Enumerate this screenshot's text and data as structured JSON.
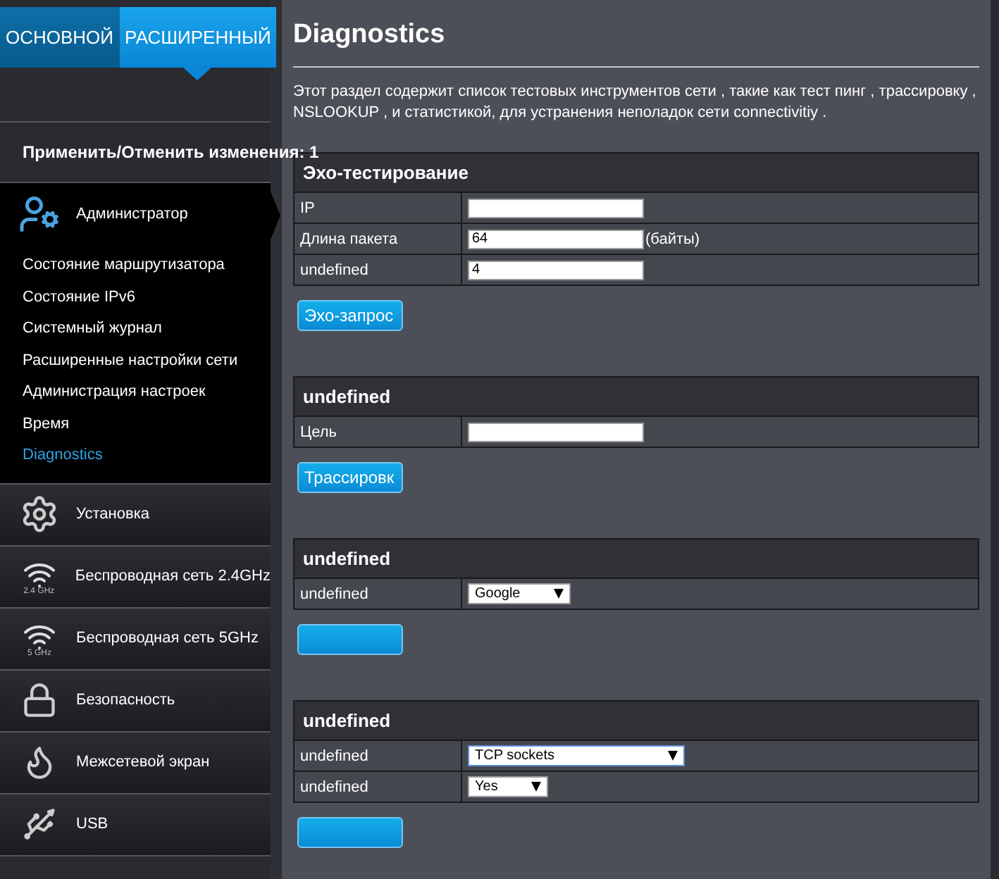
{
  "tabs": [
    {
      "label": "ОСНОВНОЙ",
      "selected": false
    },
    {
      "label": "РАСШИРЕННЫЙ",
      "selected": true
    }
  ],
  "apply_status": "Применить/Отменить изменения: 1",
  "sidebar": {
    "groups": [
      {
        "label": "Администратор",
        "expanded": true,
        "children": [
          {
            "label": "Состояние маршрутизатора",
            "selected": false
          },
          {
            "label": "Состояние IPv6",
            "selected": false
          },
          {
            "label": "Системный журнал",
            "selected": false
          },
          {
            "label": "Расширенные настройки сети",
            "selected": false
          },
          {
            "label": "Администрация настроек",
            "selected": false
          },
          {
            "label": "Время",
            "selected": false
          },
          {
            "label": "Diagnostics",
            "selected": true
          }
        ]
      },
      {
        "label": "Установка",
        "expanded": false
      },
      {
        "label": "Беспроводная сеть 2.4GHz",
        "band": "2.4 GHz",
        "expanded": false
      },
      {
        "label": "Беспроводная сеть 5GHz",
        "band": "5 GHz",
        "expanded": false
      },
      {
        "label": "Безопасность",
        "expanded": false
      },
      {
        "label": "Межсетевой экран",
        "expanded": false
      },
      {
        "label": "USB",
        "expanded": false
      }
    ]
  },
  "page": {
    "title": "Diagnostics",
    "description": "Этот раздел содержит список тестовых инструментов сети , такие как тест пинг , трассировку , NSLOOKUP , и статистикой, для устранения неполадок сети connectivitiy ."
  },
  "sections": [
    {
      "title": "Эхо-тестирование",
      "rows": [
        {
          "label": "IP",
          "kind": "input"
        },
        {
          "label": "Длина пакета",
          "kind": "input",
          "value": "64",
          "suffix": "(байты)"
        },
        {
          "label": "undefined",
          "kind": "input",
          "value": "4"
        }
      ],
      "has_button": true,
      "button_label": "Эхо-запрос"
    },
    {
      "title": "undefined",
      "rows": [
        {
          "label": "Цель",
          "kind": "input"
        }
      ],
      "has_button": true,
      "button_label": "Трассировк"
    },
    {
      "title": "undefined",
      "rows": [
        {
          "label": "undefined",
          "kind": "select",
          "value": "Google"
        }
      ],
      "has_button": true
    },
    {
      "title": "undefined",
      "rows": [
        {
          "label": "undefined",
          "kind": "select",
          "value": "TCP sockets",
          "focused": true
        },
        {
          "label": "undefined",
          "kind": "select",
          "value": "Yes"
        }
      ],
      "has_button": true
    }
  ]
}
